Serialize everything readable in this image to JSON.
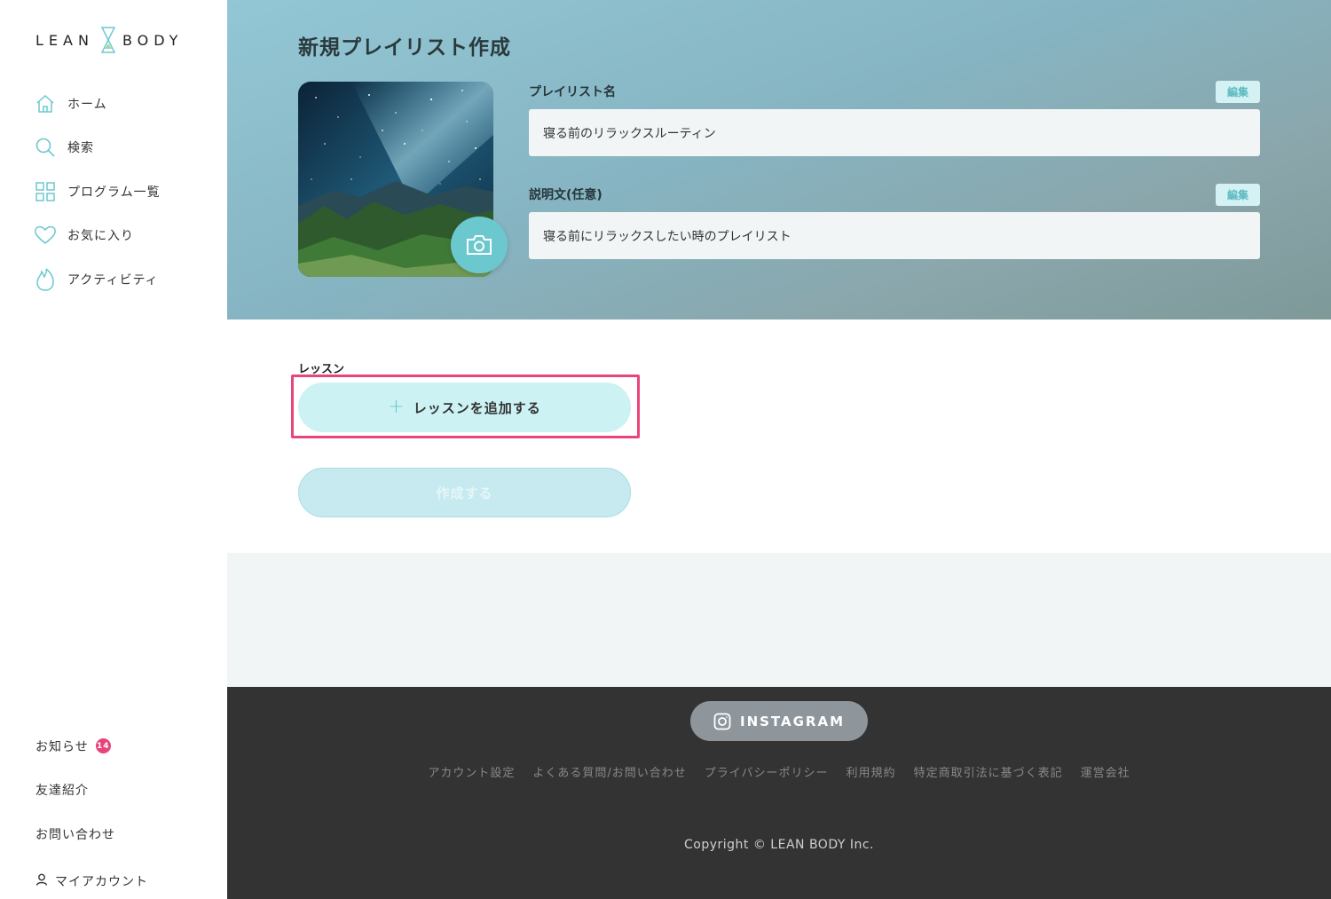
{
  "brand": {
    "left": "LEAN",
    "right": "BODY",
    "accent": "#6cc8cf"
  },
  "sidebar": {
    "items": [
      {
        "icon": "home-icon",
        "label": "ホーム"
      },
      {
        "icon": "search-icon",
        "label": "検索"
      },
      {
        "icon": "grid-icon",
        "label": "プログラム一覧"
      },
      {
        "icon": "heart-icon",
        "label": "お気に入り"
      },
      {
        "icon": "flame-icon",
        "label": "アクティビティ"
      }
    ],
    "bottom": {
      "news_label": "お知らせ",
      "news_badge": "14",
      "referral_label": "友達紹介",
      "contact_label": "お問い合わせ",
      "account_label": "マイアカウント"
    }
  },
  "page": {
    "title": "新規プレイリスト作成"
  },
  "form": {
    "name_label": "プレイリスト名",
    "name_value": "寝る前のリラックスルーティン",
    "desc_label": "説明文(任意)",
    "desc_value": "寝る前にリラックスしたい時のプレイリスト",
    "edit_label": "編集"
  },
  "lessons": {
    "label": "レッスン",
    "add_label": "レッスンを追加する",
    "create_label": "作成する"
  },
  "footer": {
    "instagram_label": "INSTAGRAM",
    "links": [
      "アカウント設定",
      "よくある質問/お問い合わせ",
      "プライバシーポリシー",
      "利用規約",
      "特定商取引法に基づく表記",
      "運営会社"
    ],
    "copyright": "Copyright © LEAN BODY Inc."
  }
}
